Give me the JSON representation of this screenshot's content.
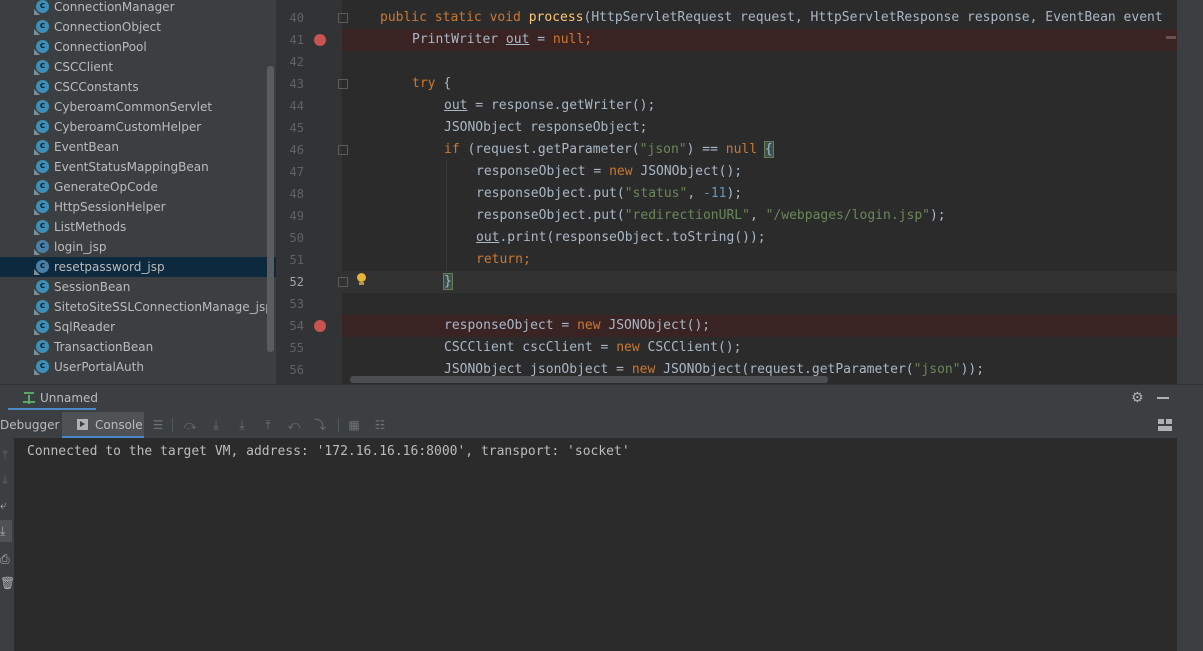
{
  "project_tree": {
    "items": [
      {
        "label": "ConnectionManager",
        "icon": "class-icon"
      },
      {
        "label": "ConnectionObject",
        "icon": "class-icon"
      },
      {
        "label": "ConnectionPool",
        "icon": "class-icon"
      },
      {
        "label": "CSCClient",
        "icon": "class-icon"
      },
      {
        "label": "CSCConstants",
        "icon": "class-icon"
      },
      {
        "label": "CyberoamCommonServlet",
        "icon": "class-icon"
      },
      {
        "label": "CyberoamCustomHelper",
        "icon": "class-icon"
      },
      {
        "label": "EventBean",
        "icon": "class-icon"
      },
      {
        "label": "EventStatusMappingBean",
        "icon": "class-icon"
      },
      {
        "label": "GenerateOpCode",
        "icon": "class-icon"
      },
      {
        "label": "HttpSessionHelper",
        "icon": "class-icon"
      },
      {
        "label": "ListMethods",
        "icon": "class-icon"
      },
      {
        "label": "login_jsp",
        "icon": "jsp-class-icon"
      },
      {
        "label": "resetpassword_jsp",
        "icon": "jsp-class-icon",
        "selected": true
      },
      {
        "label": "SessionBean",
        "icon": "class-icon"
      },
      {
        "label": "SitetoSiteSSLConnectionManage_jsp",
        "icon": "class-icon"
      },
      {
        "label": "SqlReader",
        "icon": "class-icon"
      },
      {
        "label": "TransactionBean",
        "icon": "class-icon"
      },
      {
        "label": "UserPortalAuth",
        "icon": "class-icon"
      }
    ]
  },
  "editor": {
    "lines": [
      {
        "n": "40",
        "parts": [
          [
            "kw",
            "public static void "
          ],
          [
            "fn",
            "process"
          ],
          [
            "",
            "(HttpServletRequest request, HttpServletResponse response, EventBean event"
          ]
        ]
      },
      {
        "n": "41",
        "parts": [
          [
            "",
            "PrintWriter "
          ],
          [
            "fld",
            "out"
          ],
          [
            "",
            " = "
          ],
          [
            "kw",
            "null"
          ],
          [
            "kw",
            ";"
          ]
        ]
      },
      {
        "n": "42",
        "parts": []
      },
      {
        "n": "43",
        "parts": [
          [
            "kw",
            "try "
          ],
          [
            "",
            "{"
          ]
        ]
      },
      {
        "n": "44",
        "parts": [
          [
            "fld",
            "out"
          ],
          [
            "",
            " = response.getWriter();"
          ]
        ]
      },
      {
        "n": "45",
        "parts": [
          [
            "",
            "JSONObject responseObject;"
          ]
        ]
      },
      {
        "n": "46",
        "parts": [
          [
            "kw",
            "if "
          ],
          [
            "",
            "(request.getParameter("
          ],
          [
            "str",
            "\"json\""
          ],
          [
            "",
            ") == "
          ],
          [
            "kw",
            "null"
          ],
          [
            "",
            " "
          ],
          [
            "brace",
            "{"
          ]
        ]
      },
      {
        "n": "47",
        "parts": [
          [
            "",
            "responseObject = "
          ],
          [
            "kw",
            "new "
          ],
          [
            "",
            "JSONObject();"
          ]
        ]
      },
      {
        "n": "48",
        "parts": [
          [
            "",
            "responseObject.put("
          ],
          [
            "str",
            "\"status\""
          ],
          [
            "",
            ", "
          ],
          [
            "num",
            "-11"
          ],
          [
            "",
            ");"
          ]
        ]
      },
      {
        "n": "49",
        "parts": [
          [
            "",
            "responseObject.put("
          ],
          [
            "str",
            "\"redirectionURL\""
          ],
          [
            "",
            ", "
          ],
          [
            "str",
            "\"/webpages/login.jsp\""
          ],
          [
            "",
            ");"
          ]
        ]
      },
      {
        "n": "50",
        "parts": [
          [
            "fld",
            "out"
          ],
          [
            "",
            ".print(responseObject.toString());"
          ]
        ]
      },
      {
        "n": "51",
        "parts": [
          [
            "kw",
            "return;"
          ]
        ]
      },
      {
        "n": "52",
        "parts": [
          [
            "brace",
            "}"
          ]
        ]
      },
      {
        "n": "53",
        "parts": []
      },
      {
        "n": "54",
        "parts": [
          [
            "",
            "responseObject = "
          ],
          [
            "kw",
            "new "
          ],
          [
            "",
            "JSONObject();"
          ]
        ]
      },
      {
        "n": "55",
        "parts": [
          [
            "",
            "CSCClient cscClient = "
          ],
          [
            "kw",
            "new "
          ],
          [
            "",
            "CSCClient();"
          ]
        ]
      },
      {
        "n": "56",
        "parts": [
          [
            "",
            "JSONObject jsonObject = "
          ],
          [
            "kw",
            "new "
          ],
          [
            "",
            "JSONObject(request.getParameter("
          ],
          [
            "str",
            "\"json\""
          ],
          [
            "",
            "));"
          ]
        ]
      }
    ]
  },
  "debug": {
    "session_tab": "Unnamed",
    "tab_debugger": "Debugger",
    "tab_console": "Console",
    "console_output": "Connected to the target VM, address: '172.16.16.16:8000', transport: 'socket'"
  }
}
